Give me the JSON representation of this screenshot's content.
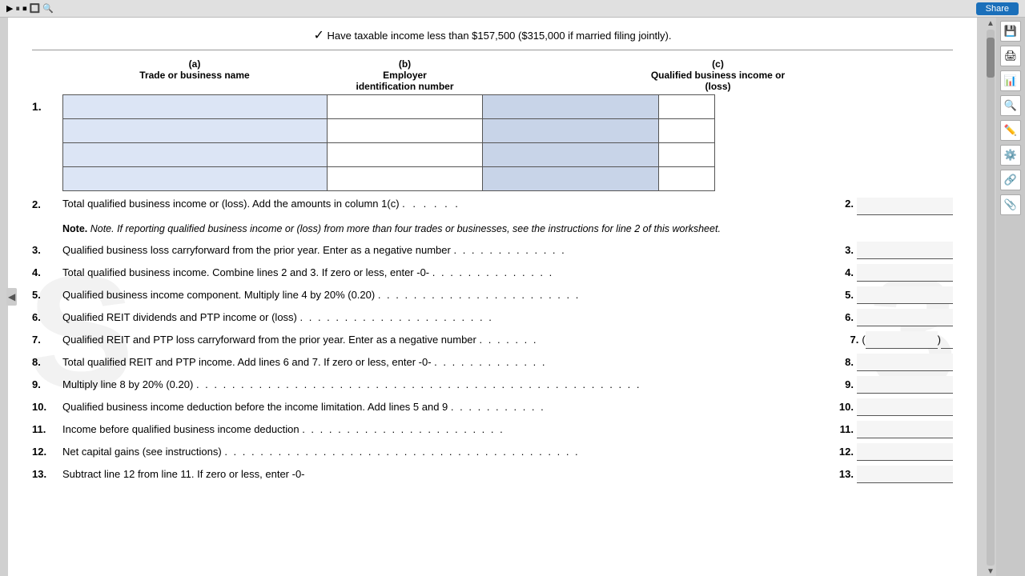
{
  "topBar": {
    "shareLabel": "Share"
  },
  "taxableNote": {
    "checkmark": "✓",
    "text": "Have taxable income less than $157,500 ($315,000 if married filing jointly)."
  },
  "watermark": "S",
  "watermark2": "3",
  "section1": {
    "num": "1.",
    "colA": {
      "label": "(a)",
      "sublabel": "Trade or business name"
    },
    "colB": {
      "label": "(b)",
      "sublabel": "Employer identification number"
    },
    "colC": {
      "label": "(c)",
      "sublabel": "Qualified business income or (loss)"
    }
  },
  "line2": {
    "num": "2.",
    "text": "Total qualified business income or (loss). Add the amounts in column 1(c)",
    "dots": ". . . . . .",
    "ref": "2.",
    "note": "Note. If reporting qualified business income or (loss) from more than four trades or businesses, see the instructions for line 2 of this worksheet."
  },
  "line3": {
    "num": "3.",
    "text": "Qualified business loss carryforward from the prior year. Enter as a negative number",
    "dots": ". . . . . . . . . . . . .",
    "ref": "3."
  },
  "line4": {
    "num": "4.",
    "text": "Total qualified business income. Combine lines 2 and 3. If zero or less, enter -0-",
    "dots": ". . . . . . . . . . . . . .",
    "ref": "4."
  },
  "line5": {
    "num": "5.",
    "text": "Qualified business income component. Multiply line 4 by 20% (0.20)",
    "dots": ". . . . . . . . . . . . . . . . . . . . . . .",
    "ref": "5."
  },
  "line6": {
    "num": "6.",
    "text": "Qualified REIT dividends and PTP income or (loss)",
    "dots": ". . . . . . . . . . . . . . . . . . . . . .",
    "ref": "6."
  },
  "line7": {
    "num": "7.",
    "text": "Qualified REIT and PTP loss carryforward from the prior year. Enter as a negative number",
    "dots": ". . . . . . .",
    "ref": "7.",
    "parens": "(__________)"
  },
  "line8": {
    "num": "8.",
    "text": "Total qualified REIT and PTP income. Add lines 6 and 7. If zero or less, enter -0-",
    "dots": ". . . . . . . . . . . . .",
    "ref": "8."
  },
  "line9": {
    "num": "9.",
    "text": "Multiply line 8 by 20% (0.20)",
    "dots": ". . . . . . . . . . . . . . . . . . . . . . . . . . . . . . . . . . . . . . . . . . . . . . . . . .",
    "ref": "9."
  },
  "line10": {
    "num": "10.",
    "text": "Qualified business income deduction before the income limitation. Add lines 5 and 9",
    "dots": ". . . . . . . . . . .",
    "ref": "10."
  },
  "line11": {
    "num": "11.",
    "text": "Income before qualified business income deduction",
    "dots": ". . . . . . . . . . . . . . . . . . . . . . .",
    "ref": "11."
  },
  "line12": {
    "num": "12.",
    "text": "Net capital gains (see instructions)",
    "dots": ". . . . . . . . . . . . . . . . . . . . . . . . . . . . . . . . . . . . . . . .",
    "ref": "12."
  },
  "line13": {
    "num": "13.",
    "text": "Subtract line 12 from line 11. If zero or less, enter -0-",
    "dots": "",
    "ref": "13."
  },
  "sidebar": {
    "icons": [
      "💾",
      "🖨",
      "📊",
      "🔍",
      "✏️",
      "⚙️",
      "🔗",
      "📎"
    ]
  }
}
